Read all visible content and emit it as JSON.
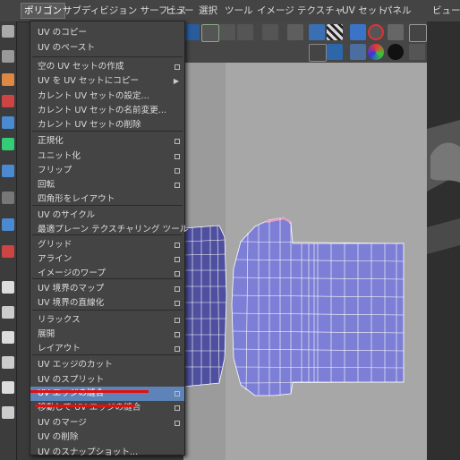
{
  "menubar": {
    "items": [
      "ポリゴン",
      "サブディビジョン サーフェス",
      "ビュー",
      "選択",
      "ツール",
      "イメージ",
      "テクスチャ",
      "UV セット",
      "パネル",
      "ビュー"
    ]
  },
  "menu": {
    "title": "ポリゴン",
    "items": [
      {
        "label": "UV のコピー",
        "option": false,
        "submenu": false
      },
      {
        "label": "UV のペースト",
        "option": false,
        "submenu": false
      },
      {
        "label": "空の UV セットの作成",
        "option": true,
        "submenu": false
      },
      {
        "label": "UV を UV セットにコピー",
        "option": false,
        "submenu": true
      },
      {
        "label": "カレント UV セットの設定...",
        "option": false,
        "submenu": false
      },
      {
        "label": "カレント UV セットの名前変更...",
        "option": false,
        "submenu": false
      },
      {
        "label": "カレント UV セットの削除",
        "option": false,
        "submenu": false
      },
      {
        "label": "正規化",
        "option": true,
        "submenu": false
      },
      {
        "label": "ユニット化",
        "option": true,
        "submenu": false
      },
      {
        "label": "フリップ",
        "option": true,
        "submenu": false
      },
      {
        "label": "回転",
        "option": true,
        "submenu": false
      },
      {
        "label": "四角形をレイアウト",
        "option": false,
        "submenu": false
      },
      {
        "label": "UV のサイクル",
        "option": false,
        "submenu": false
      },
      {
        "label": "最適プレーン テクスチャリング ツール",
        "option": false,
        "submenu": false
      },
      {
        "label": "グリッド",
        "option": true,
        "submenu": false
      },
      {
        "label": "アライン",
        "option": true,
        "submenu": false
      },
      {
        "label": "イメージのワープ",
        "option": true,
        "submenu": false
      },
      {
        "label": "UV 境界のマップ",
        "option": true,
        "submenu": false
      },
      {
        "label": "UV 境界の直線化",
        "option": true,
        "submenu": false
      },
      {
        "label": "リラックス",
        "option": true,
        "submenu": false
      },
      {
        "label": "展開",
        "option": true,
        "submenu": false
      },
      {
        "label": "レイアウト",
        "option": true,
        "submenu": false
      },
      {
        "label": "UV エッジのカット",
        "option": false,
        "submenu": false
      },
      {
        "label": "UV のスプリット",
        "option": false,
        "submenu": false
      },
      {
        "label": "UV エッジの縫合",
        "option": true,
        "submenu": false
      },
      {
        "label": "移動して UV エッジの縫合",
        "option": true,
        "submenu": false
      },
      {
        "label": "UV のマージ",
        "option": true,
        "submenu": false
      },
      {
        "label": "UV の削除",
        "option": false,
        "submenu": false
      },
      {
        "label": "UV のスナップショット...",
        "option": false,
        "submenu": false
      }
    ],
    "highlighted_index": 24,
    "underlined_indices": [
      24,
      25
    ]
  },
  "colors": {
    "menu_bg": "#444444",
    "highlight": "#5d83b8",
    "underline": "#e31010",
    "uv_shell": "#7d7fd6",
    "uv_shell_dark": "#4e4f9e",
    "viewport_bg": "#a7a7a7"
  },
  "icons": [
    "select-arrow-icon",
    "lasso-icon",
    "paint-icon",
    "move-icon",
    "rotate-icon",
    "scale-icon",
    "uv-tool-icon"
  ]
}
